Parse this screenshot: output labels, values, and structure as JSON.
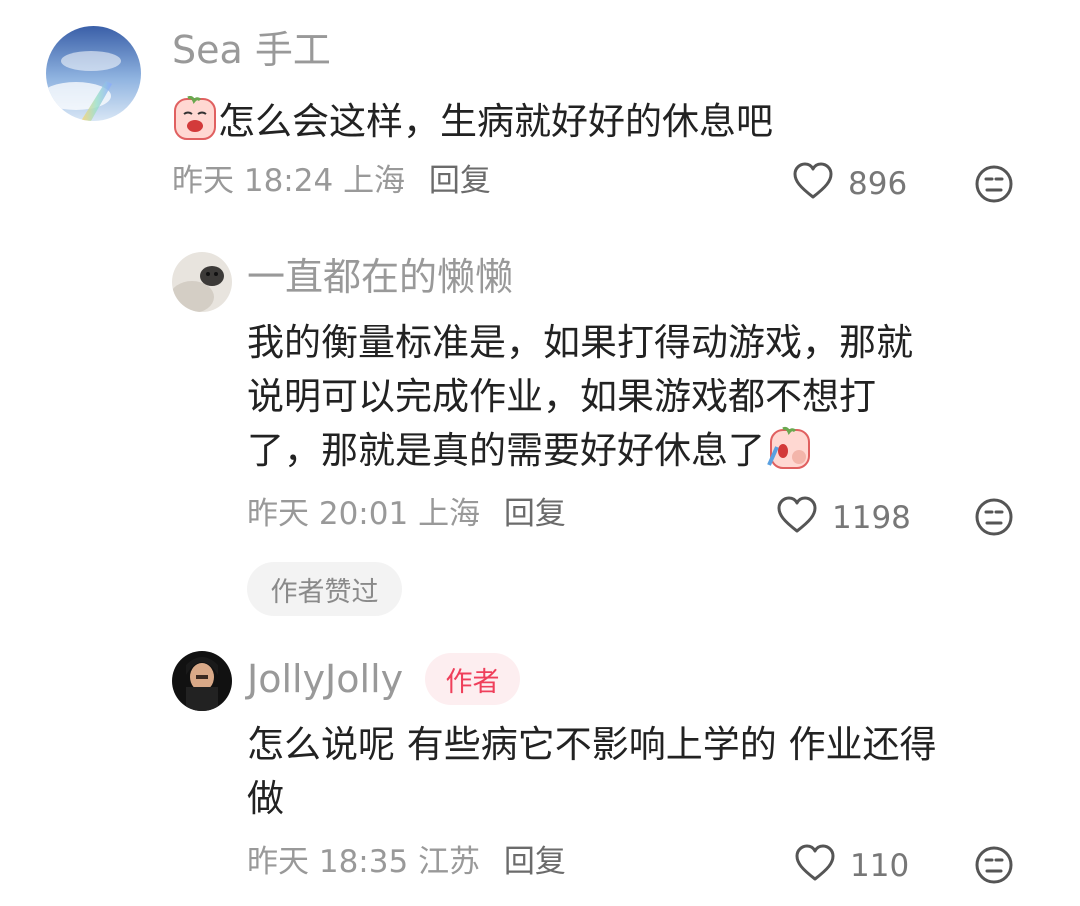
{
  "comments": [
    {
      "username": "Sea 手工",
      "text": "怎么会这样，生病就好好的休息吧",
      "emoji": "crying-face-sticker",
      "time": "昨天 18:24",
      "location": "上海",
      "reply_label": "回复",
      "likes": "896"
    },
    {
      "username": "一直都在的懒懒",
      "text_line1": "我的衡量标准是，如果打得动游戏，那就",
      "text_line2": "说明可以完成作业，如果游戏都不想打",
      "text_line3": "了，那就是真的需要好好休息了",
      "emoji": "crying-face-sticker",
      "time": "昨天 20:01",
      "location": "上海",
      "reply_label": "回复",
      "likes": "1198",
      "badge": "作者赞过"
    },
    {
      "username": "JollyJolly",
      "author_tag": "作者",
      "text_line1": "怎么说呢 有些病它不影响上学的 作业还得",
      "text_line2": "做",
      "time": "昨天 18:35",
      "location": "江苏",
      "reply_label": "回复",
      "likes": "110"
    }
  ],
  "icons": {
    "like": "heart-outline-icon",
    "dislike": "neutral-face-icon"
  },
  "colors": {
    "secondary_text": "#999999",
    "author_tag_text": "#ef3f5b",
    "author_tag_bg": "#fdeef0"
  }
}
